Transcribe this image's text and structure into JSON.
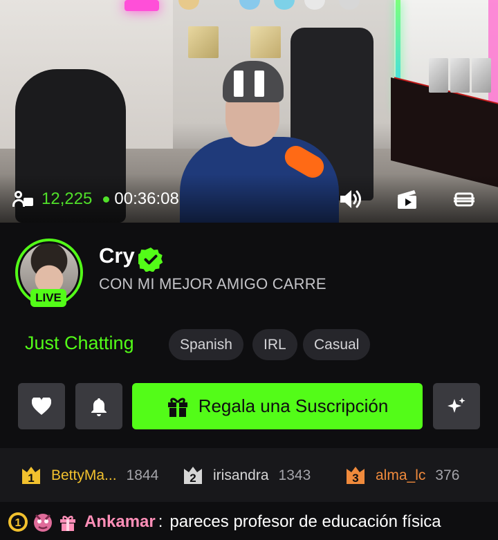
{
  "stream": {
    "viewers": "12,225",
    "elapsed": "00:36:08"
  },
  "channel": {
    "name": "Cry",
    "title": "CON MI MEJOR AMIGO CARRE",
    "live_badge": "LIVE",
    "verified": true
  },
  "category": "Just Chatting",
  "tags": [
    "Spanish",
    "IRL",
    "Casual"
  ],
  "actions": {
    "gift_label": "Regala una Suscripción"
  },
  "leaderboard": [
    {
      "rank": "1",
      "name": "BettyMa...",
      "score": "1844",
      "color": "#f2c12e"
    },
    {
      "rank": "2",
      "name": "irisandra",
      "score": "1343",
      "color": "#d6d6d6"
    },
    {
      "rank": "3",
      "name": "alma_lc",
      "score": "376",
      "color": "#f08a3c"
    }
  ],
  "chat": {
    "badge_rank": "1",
    "username": "Ankamar",
    "separator": ":",
    "message": "pareces profesor de educación física"
  },
  "colors": {
    "accent": "#53fc18",
    "background": "#0e0e10",
    "chat_user": "#ff8fb8"
  },
  "icons": [
    "viewers-icon",
    "volume-icon",
    "clip-icon",
    "pip-icon",
    "verified-icon",
    "heart-icon",
    "bell-icon",
    "gift-icon",
    "sparkle-icon",
    "rank-badge-icon"
  ]
}
